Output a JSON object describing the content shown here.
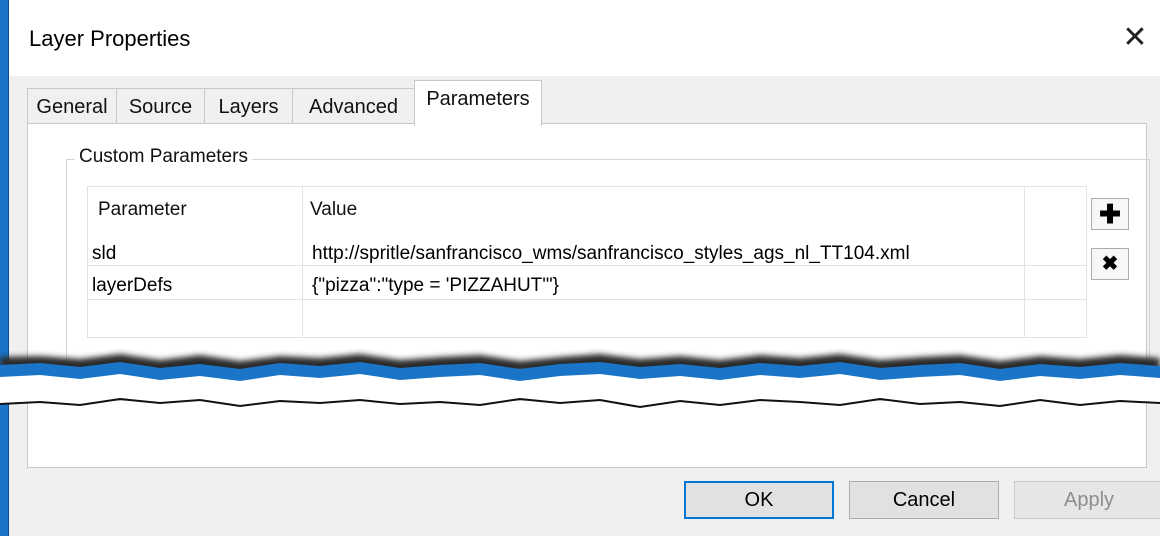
{
  "window": {
    "title": "Layer Properties",
    "close_glyph": "✕"
  },
  "tabs": [
    {
      "label": "General"
    },
    {
      "label": "Source"
    },
    {
      "label": "Layers"
    },
    {
      "label": "Advanced"
    },
    {
      "label": "Parameters"
    }
  ],
  "active_tab": "Parameters",
  "custom_parameters": {
    "group_label": "Custom Parameters",
    "columns": [
      "Parameter",
      "Value"
    ],
    "rows": [
      {
        "parameter": "sld",
        "value": "http://spritle/sanfrancisco_wms/sanfrancisco_styles_ags_nl_TT104.xml"
      },
      {
        "parameter": "layerDefs",
        "value": "{\"pizza\":\"type = 'PIZZAHUT'\"}"
      }
    ],
    "add_glyph": "✚",
    "remove_glyph": "✖"
  },
  "buttons": {
    "ok": "OK",
    "cancel": "Cancel",
    "apply": "Apply"
  },
  "colors": {
    "desktop": "#1a74c8",
    "focus": "#0078d7"
  }
}
